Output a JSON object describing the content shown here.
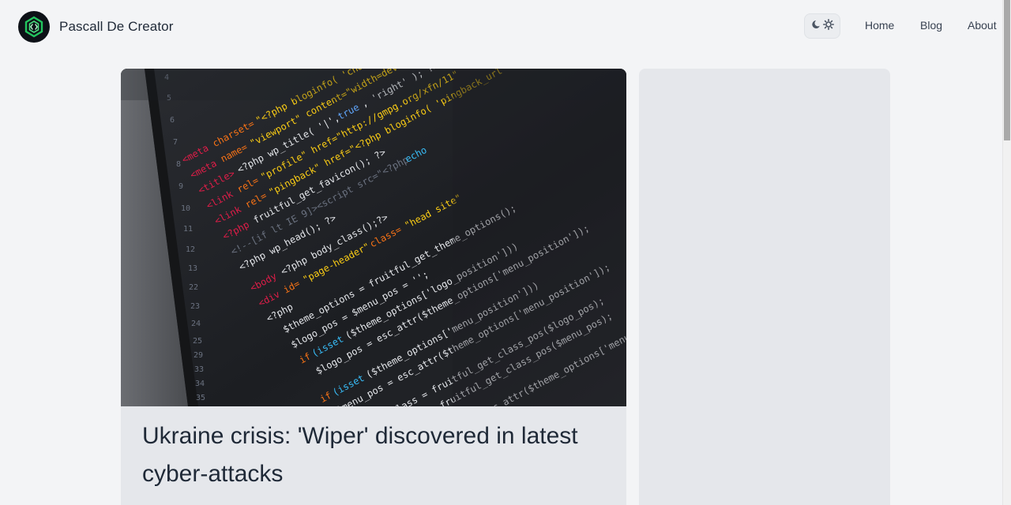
{
  "header": {
    "brand_name": "Pascall De Creator",
    "logo_icon": "code-hexagon-logo",
    "theme_toggle_icons": [
      "moon-icon",
      "sun-icon"
    ],
    "nav": [
      {
        "label": "Home"
      },
      {
        "label": "Blog"
      },
      {
        "label": "About"
      }
    ]
  },
  "main": {
    "featured_post": {
      "image_alt": "code-on-screen",
      "title": "Ukraine crisis: 'Wiper' discovered in latest cyber-attacks"
    }
  },
  "colors": {
    "background": "#f3f4f6",
    "card": "#e5e7eb",
    "text": "#1f2937",
    "logo_bg": "#0d1117",
    "logo_accent": "#22c55e"
  }
}
